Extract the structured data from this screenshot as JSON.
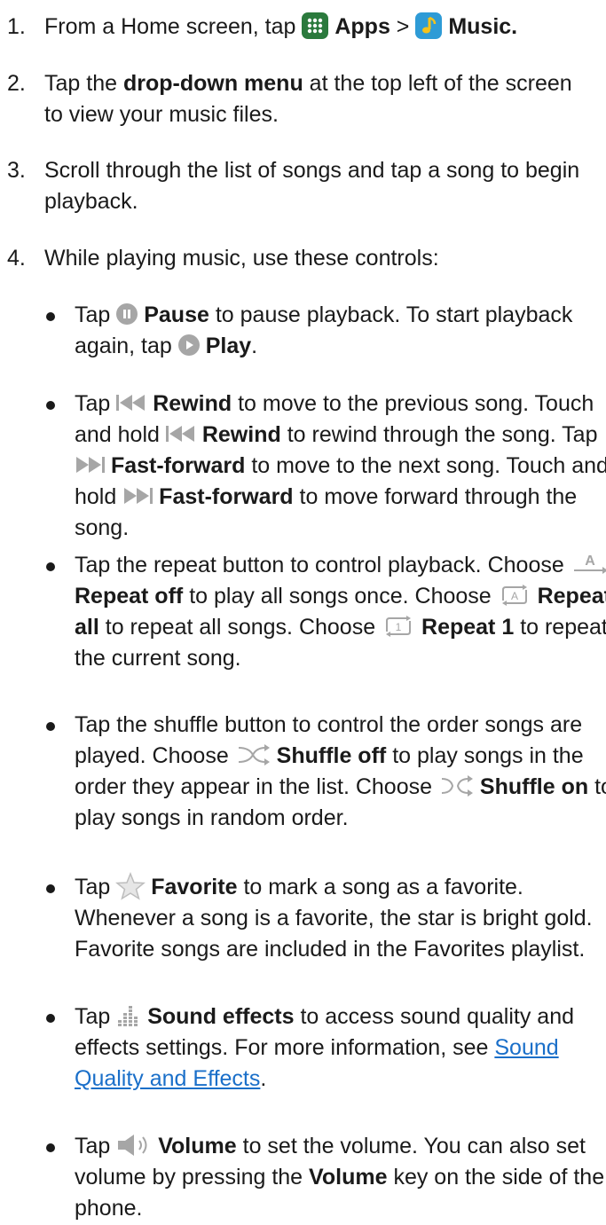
{
  "step1": {
    "num": "1.",
    "t1": "From a Home screen, tap",
    "apps": "Apps",
    "sep": ">",
    "music": "Music."
  },
  "step2": {
    "num": "2.",
    "t1": "Tap the",
    "b1": "drop-down menu",
    "t2": "at the top left of the screen to view your music files."
  },
  "step3": {
    "num": "3.",
    "t1": "Scroll through the list of songs and tap a song to begin playback."
  },
  "step4": {
    "num": "4.",
    "t1": "While playing music, use these controls:"
  },
  "bullets": {
    "pause": {
      "t1": "Tap",
      "b1": "Pause",
      "t2": "to pause playback. To start playback again, tap",
      "b2": "Play",
      "t3": "."
    },
    "rewind": {
      "t1": "Tap",
      "b1": "Rewind",
      "t2": "to move to the previous song. Touch and hold",
      "b2": "Rewind",
      "t3": "to rewind through the song. Tap",
      "b3": "Fast-forward",
      "t4": "to move to the next song. Touch and hold",
      "b4": "Fast-forward",
      "t5": "to move forward through the song."
    },
    "repeat": {
      "t1": "Tap the repeat button to control playback. Choose",
      "b1": "Repeat off",
      "t2": "to play all songs once. Choose",
      "b2": "Repeat all",
      "t3": "to repeat all songs. Choose",
      "b3": "Repeat 1",
      "t4": "to repeat the current song."
    },
    "shuffle": {
      "t1": "Tap the shuffle button to control the order songs are played. Choose",
      "b1": "Shuffle off",
      "t2": "to play songs in the order they appear in the list. Choose",
      "b2": "Shuffle on",
      "t3": "to play songs in random order."
    },
    "favorite": {
      "t1": "Tap",
      "b1": "Favorite",
      "t2": "to mark a song as a favorite. Whenever a song is a favorite, the star is bright gold. Favorite songs are included in the Favorites playlist."
    },
    "sound": {
      "t1": "Tap",
      "b1": "Sound effects",
      "t2": "to access sound quality and effects settings. For more information, see",
      "link": "Sound Quality and Effects",
      "t3": "."
    },
    "volume": {
      "t1": "Tap",
      "b1": "Volume",
      "t2": "to set the volume. You can also set volume by pressing the",
      "b2": "Volume",
      "t3": "key on the side of the phone."
    }
  },
  "icons": {
    "apps": "apps-grid-icon",
    "music": "music-note-icon",
    "pause": "pause-icon",
    "play": "play-icon",
    "rewind": "rewind-icon",
    "fast_forward": "fast-forward-icon",
    "repeat_off": "repeat-off-icon",
    "repeat_all": "repeat-all-icon",
    "repeat_one": "repeat-one-icon",
    "shuffle_off": "shuffle-off-icon",
    "shuffle_on": "shuffle-on-icon",
    "favorite": "star-icon",
    "sound_effects": "sound-effects-icon",
    "volume": "volume-icon"
  },
  "icon_glyphs": {
    "repeat_off": "A",
    "repeat_all": "A",
    "repeat_one": "1"
  },
  "colors": {
    "text": "#1a1a1a",
    "link": "#1a6fc9",
    "apps_icon": "#2b7a3d",
    "music_icon": "#2e9bd6",
    "music_note": "#f4c21b",
    "control_gray": "#a6a6a6",
    "star_gray": "#bdbdbd"
  }
}
